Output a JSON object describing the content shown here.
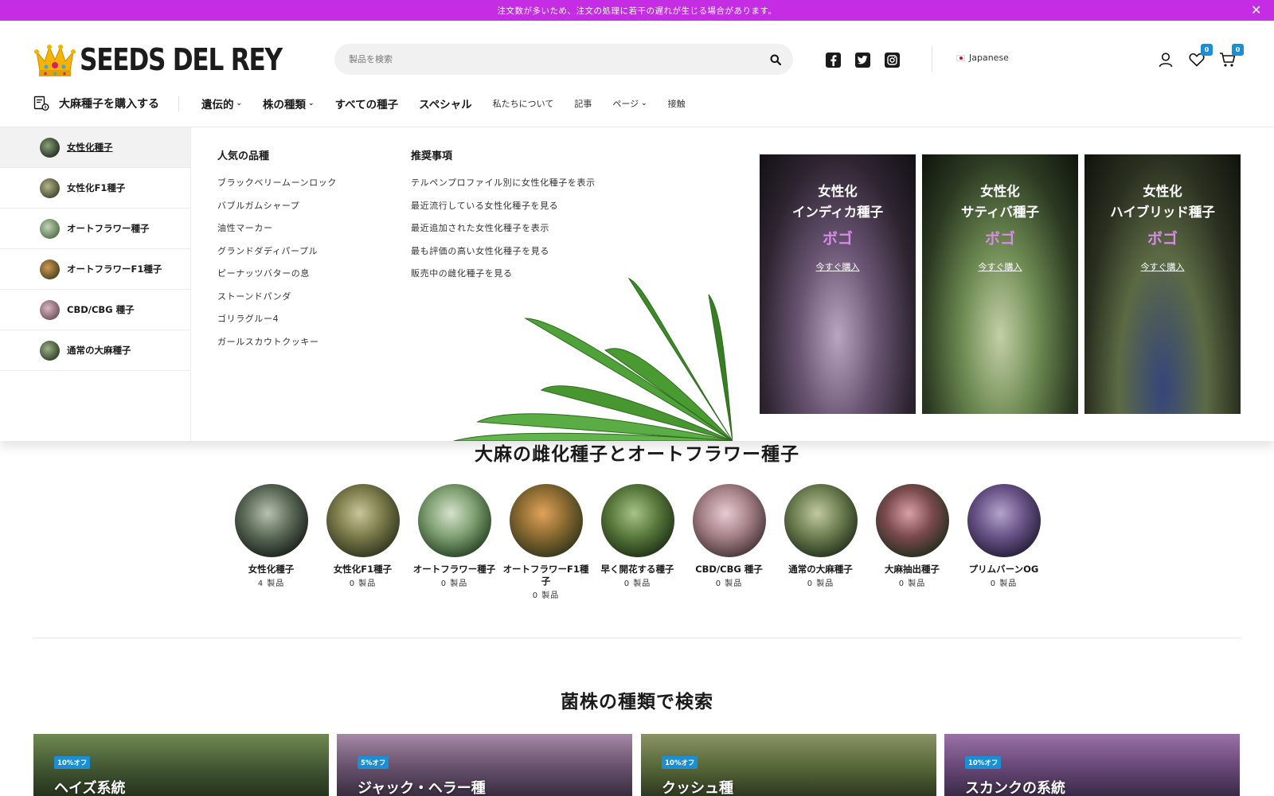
{
  "announcement": {
    "text": "注文数が多いため、注文の処理に若干の遅れが生じる場合があります。",
    "close": "✕"
  },
  "header": {
    "logo_text": "SEEDS DEL REY",
    "search_placeholder": "製品を検索",
    "language": "Japanese",
    "wishlist_count": "0",
    "cart_count": "0"
  },
  "nav": {
    "buy_label": "大麻種子を購入する",
    "items": [
      {
        "label": "遺伝的",
        "chevron": "⌄"
      },
      {
        "label": "株の種類",
        "chevron": "⌄"
      },
      {
        "label": "すべての種子"
      },
      {
        "label": "スペシャル"
      },
      {
        "label": "私たちについて"
      },
      {
        "label": "記事"
      },
      {
        "label": "ページ",
        "chevron": "⌄"
      },
      {
        "label": "接触"
      }
    ]
  },
  "mega_menu": {
    "categories": [
      {
        "label": "女性化種子"
      },
      {
        "label": "女性化F1種子"
      },
      {
        "label": "オートフラワー種子"
      },
      {
        "label": "オートフラワーF1種子"
      },
      {
        "label": "CBD/CBG 種子"
      },
      {
        "label": "通常の大麻種子"
      }
    ],
    "popular": {
      "heading": "人気の品種",
      "items": [
        "ブラックベリームーンロック",
        "バブルガムシャープ",
        "油性マーカー",
        "グランドダディパープル",
        "ピーナッツバターの息",
        "ストーンドパンダ",
        "ゴリラグルー4",
        "ガールスカウトクッキー"
      ]
    },
    "recommended": {
      "heading": "推奨事項",
      "items": [
        "テルペンプロファイル別に女性化種子を表示",
        "最近流行している女性化種子を見る",
        "最近追加された女性化種子を表示",
        "最も評価の高い女性化種子を見る",
        "販売中の雌化種子を見る"
      ]
    },
    "promos": [
      {
        "line1": "女性化",
        "line2": "インディカ種子",
        "brand": "ボゴ",
        "link": "今すぐ購入"
      },
      {
        "line1": "女性化",
        "line2": "サティバ種子",
        "brand": "ボゴ",
        "link": "今すぐ購入"
      },
      {
        "line1": "女性化",
        "line2": "ハイブリッド種子",
        "brand": "ボゴ",
        "link": "今すぐ購入"
      }
    ]
  },
  "categories_section": {
    "title": "大麻の雌化種子とオートフラワー種子",
    "items": [
      {
        "name": "女性化種子",
        "count": "4 製品"
      },
      {
        "name": "女性化F1種子",
        "count": "0 製品"
      },
      {
        "name": "オートフラワー種子",
        "count": "0 製品"
      },
      {
        "name": "オートフラワーF1種子",
        "count": "0 製品"
      },
      {
        "name": "早く開花する種子",
        "count": "0 製品"
      },
      {
        "name": "CBD/CBG 種子",
        "count": "0 製品"
      },
      {
        "name": "通常の大麻種子",
        "count": "0 製品"
      },
      {
        "name": "大麻抽出種子",
        "count": "0 製品"
      },
      {
        "name": "プリムバーンOG",
        "count": "0 製品"
      }
    ]
  },
  "strain_section": {
    "title": "菌株の種類で検索",
    "cards": [
      {
        "badge": "10%オフ",
        "name": "ヘイズ系統"
      },
      {
        "badge": "5%オフ",
        "name": "ジャック・ヘラー種"
      },
      {
        "badge": "10%オフ",
        "name": "クッシュ種"
      },
      {
        "badge": "10%オフ",
        "name": "スカンクの系統"
      }
    ]
  },
  "colors": {
    "announcement_bg": "#c42de3",
    "badge_blue": "#1a8fd6",
    "promo_accent": "#d88be8"
  }
}
